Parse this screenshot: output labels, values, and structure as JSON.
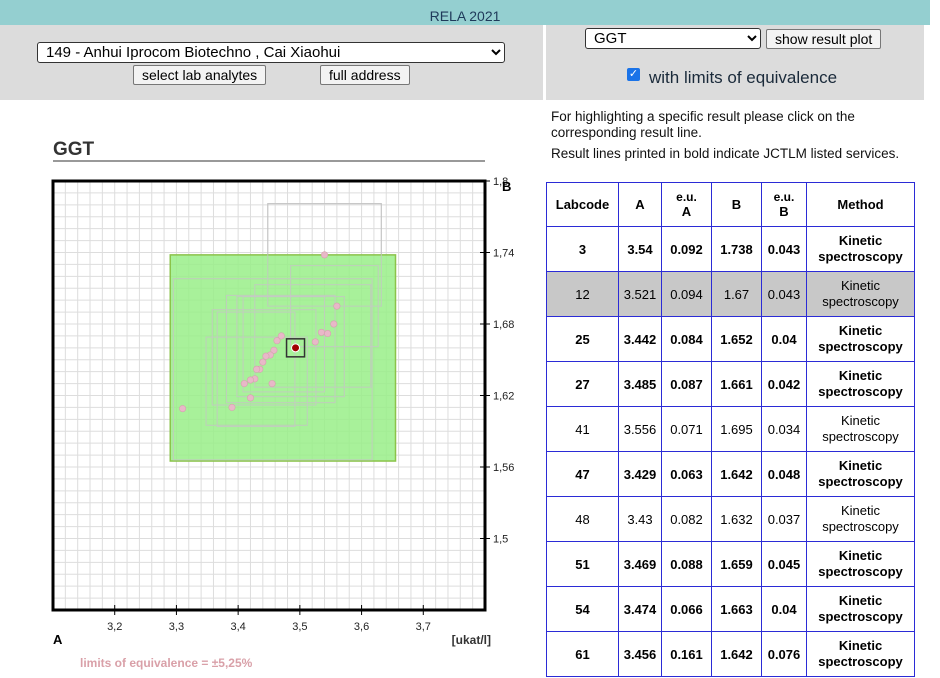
{
  "header": {
    "title": "RELA 2021"
  },
  "lab": {
    "selected": "149 - Anhui Iprocom Biotechno , Cai Xiaohui",
    "select_analytes_label": "select lab analytes",
    "full_address_label": "full address"
  },
  "analyte": {
    "selected": "GGT",
    "show_plot_label": "show result plot",
    "limits_label": "with limits of equivalence",
    "limits_checked": true
  },
  "info": {
    "line1": "For highlighting a specific result please click on the corresponding result line.",
    "line2": "Result lines printed in bold indicate JCTLM listed services."
  },
  "table": {
    "headers": [
      "Labcode",
      "A",
      "e.u. A",
      "B",
      "e.u. B",
      "Method"
    ],
    "rows": [
      {
        "labcode": "3",
        "a": "3.54",
        "eua": "0.092",
        "b": "1.738",
        "eub": "0.043",
        "method": "Kinetic spectroscopy",
        "bold": true,
        "selected": false
      },
      {
        "labcode": "12",
        "a": "3.521",
        "eua": "0.094",
        "b": "1.67",
        "eub": "0.043",
        "method": "Kinetic spectroscopy",
        "bold": false,
        "selected": true
      },
      {
        "labcode": "25",
        "a": "3.442",
        "eua": "0.084",
        "b": "1.652",
        "eub": "0.04",
        "method": "Kinetic spectroscopy",
        "bold": true,
        "selected": false
      },
      {
        "labcode": "27",
        "a": "3.485",
        "eua": "0.087",
        "b": "1.661",
        "eub": "0.042",
        "method": "Kinetic spectroscopy",
        "bold": true,
        "selected": false
      },
      {
        "labcode": "41",
        "a": "3.556",
        "eua": "0.071",
        "b": "1.695",
        "eub": "0.034",
        "method": "Kinetic spectroscopy",
        "bold": false,
        "selected": false
      },
      {
        "labcode": "47",
        "a": "3.429",
        "eua": "0.063",
        "b": "1.642",
        "eub": "0.048",
        "method": "Kinetic spectroscopy",
        "bold": true,
        "selected": false
      },
      {
        "labcode": "48",
        "a": "3.43",
        "eua": "0.082",
        "b": "1.632",
        "eub": "0.037",
        "method": "Kinetic spectroscopy",
        "bold": false,
        "selected": false
      },
      {
        "labcode": "51",
        "a": "3.469",
        "eua": "0.088",
        "b": "1.659",
        "eub": "0.045",
        "method": "Kinetic spectroscopy",
        "bold": true,
        "selected": false
      },
      {
        "labcode": "54",
        "a": "3.474",
        "eua": "0.066",
        "b": "1.663",
        "eub": "0.04",
        "method": "Kinetic spectroscopy",
        "bold": true,
        "selected": false
      },
      {
        "labcode": "61",
        "a": "3.456",
        "eua": "0.161",
        "b": "1.642",
        "eub": "0.076",
        "method": "Kinetic spectroscopy",
        "bold": true,
        "selected": false
      }
    ]
  },
  "chart_data": {
    "type": "scatter",
    "title": "GGT",
    "xlabel": "A",
    "ylabel": "B",
    "unit_label": "[ukat/l]",
    "xlim": [
      3.1,
      3.8
    ],
    "ylim": [
      1.44,
      1.8
    ],
    "x_ticks": [
      "3,2",
      "3,3",
      "3,4",
      "3,5",
      "3,6",
      "3,7"
    ],
    "y_ticks": [
      "1,8",
      "1,74",
      "1,68",
      "1,62",
      "1,56",
      "1,5"
    ],
    "y_tick_values": [
      1.8,
      1.74,
      1.68,
      1.62,
      1.56,
      1.5
    ],
    "x_tick_values": [
      3.2,
      3.3,
      3.4,
      3.5,
      3.6,
      3.7
    ],
    "limits_text": "limits of equivalence = ±5,25%",
    "equivalence_box": {
      "x": [
        3.29,
        3.655
      ],
      "y": [
        1.565,
        1.738
      ]
    },
    "highlight": {
      "a": 3.493,
      "b": 1.66
    },
    "colors": {
      "box": "#99ee88",
      "box_border": "#8bc34a",
      "point": "#e8b8c8",
      "highlight": "#a00000",
      "grid": "#dddddd"
    },
    "points": [
      {
        "a": 3.54,
        "b": 1.738
      },
      {
        "a": 3.56,
        "b": 1.695
      },
      {
        "a": 3.555,
        "b": 1.68
      },
      {
        "a": 3.535,
        "b": 1.673
      },
      {
        "a": 3.545,
        "b": 1.672
      },
      {
        "a": 3.525,
        "b": 1.665
      },
      {
        "a": 3.47,
        "b": 1.67
      },
      {
        "a": 3.463,
        "b": 1.666
      },
      {
        "a": 3.458,
        "b": 1.658
      },
      {
        "a": 3.452,
        "b": 1.654
      },
      {
        "a": 3.445,
        "b": 1.653
      },
      {
        "a": 3.44,
        "b": 1.648
      },
      {
        "a": 3.435,
        "b": 1.642
      },
      {
        "a": 3.43,
        "b": 1.642
      },
      {
        "a": 3.427,
        "b": 1.634
      },
      {
        "a": 3.42,
        "b": 1.633
      },
      {
        "a": 3.41,
        "b": 1.63
      },
      {
        "a": 3.455,
        "b": 1.63
      },
      {
        "a": 3.42,
        "b": 1.618
      },
      {
        "a": 3.31,
        "b": 1.609
      },
      {
        "a": 3.39,
        "b": 1.61
      }
    ],
    "boxes": [
      {
        "a": 3.54,
        "b": 1.738,
        "ea": 0.092,
        "eb": 0.043
      },
      {
        "a": 3.521,
        "b": 1.67,
        "ea": 0.094,
        "eb": 0.043
      },
      {
        "a": 3.442,
        "b": 1.652,
        "ea": 0.084,
        "eb": 0.04
      },
      {
        "a": 3.485,
        "b": 1.661,
        "ea": 0.087,
        "eb": 0.042
      },
      {
        "a": 3.556,
        "b": 1.695,
        "ea": 0.071,
        "eb": 0.034
      },
      {
        "a": 3.429,
        "b": 1.642,
        "ea": 0.063,
        "eb": 0.048
      },
      {
        "a": 3.43,
        "b": 1.632,
        "ea": 0.082,
        "eb": 0.037
      },
      {
        "a": 3.469,
        "b": 1.659,
        "ea": 0.088,
        "eb": 0.045
      },
      {
        "a": 3.474,
        "b": 1.663,
        "ea": 0.066,
        "eb": 0.04
      },
      {
        "a": 3.456,
        "b": 1.642,
        "ea": 0.161,
        "eb": 0.076
      }
    ]
  }
}
